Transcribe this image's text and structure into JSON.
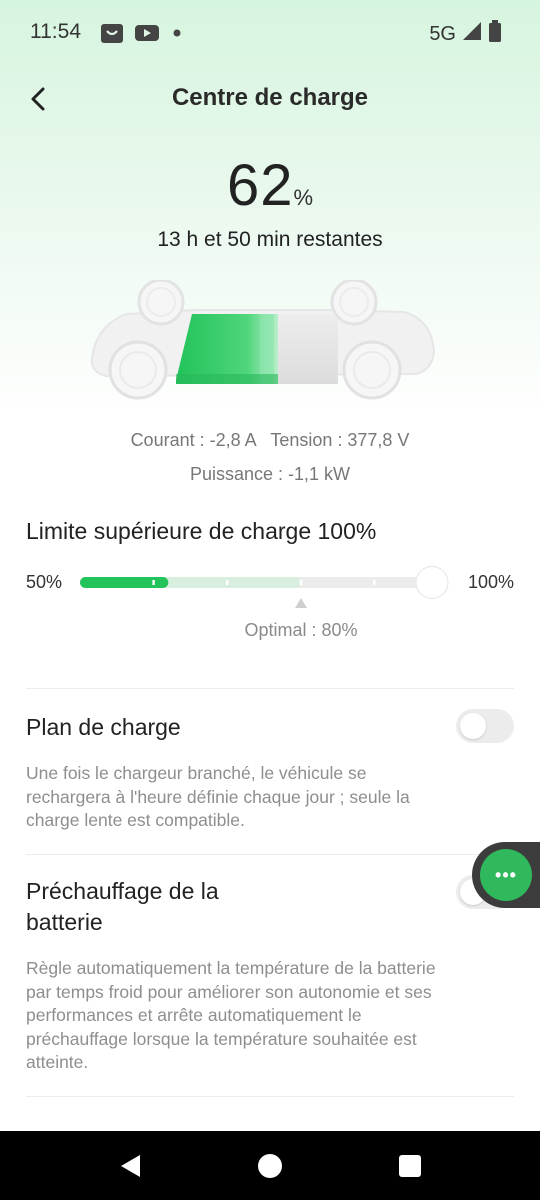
{
  "status_bar": {
    "time": "11:54",
    "network": "5G",
    "icons_left": [
      "shopping-bag-icon",
      "youtube-icon",
      "dot-icon"
    ],
    "icons_right": [
      "signal-icon",
      "battery-icon"
    ]
  },
  "header": {
    "title": "Centre de charge",
    "back_icon": "chevron-left-icon"
  },
  "charge": {
    "percent": "62",
    "percent_sign": "%",
    "remaining": "13 h et 50 min restantes",
    "level_fraction": 0.62
  },
  "metrics": {
    "line1": "Courant : -2,8 A   Tension : 377,8 V",
    "line2": "Puissance : -1,1 kW"
  },
  "limit": {
    "title": "Limite supérieure de charge 100%",
    "min_label": "50%",
    "max_label": "100%",
    "optimal_label": "Optimal : 80%",
    "range_min": 50,
    "range_max": 100,
    "value": 100,
    "current_level": 62,
    "optimal_value": 80
  },
  "settings": [
    {
      "title": "Plan de charge",
      "description": "Une fois le chargeur branché, le véhicule se rechargera à l'heure définie chaque jour ; seule la charge lente est compatible.",
      "enabled": false
    },
    {
      "title": "Préchauffage de la batterie",
      "description": "Règle automatiquement la température de la batterie par temps froid pour améliorer son autonomie et ses performances et arrête automatiquement le préchauffage lorsque la température souhaitée est atteinte.",
      "enabled": false
    }
  ],
  "floating_button": {
    "icon": "more-dots-icon",
    "label": "•••"
  },
  "colors": {
    "accent": "#2fc45e",
    "track": "#ededed",
    "text": "#222222",
    "muted": "#8e8e8e"
  },
  "nav_bar": {
    "icons": [
      "back-triangle-icon",
      "home-circle-icon",
      "recents-square-icon"
    ]
  }
}
